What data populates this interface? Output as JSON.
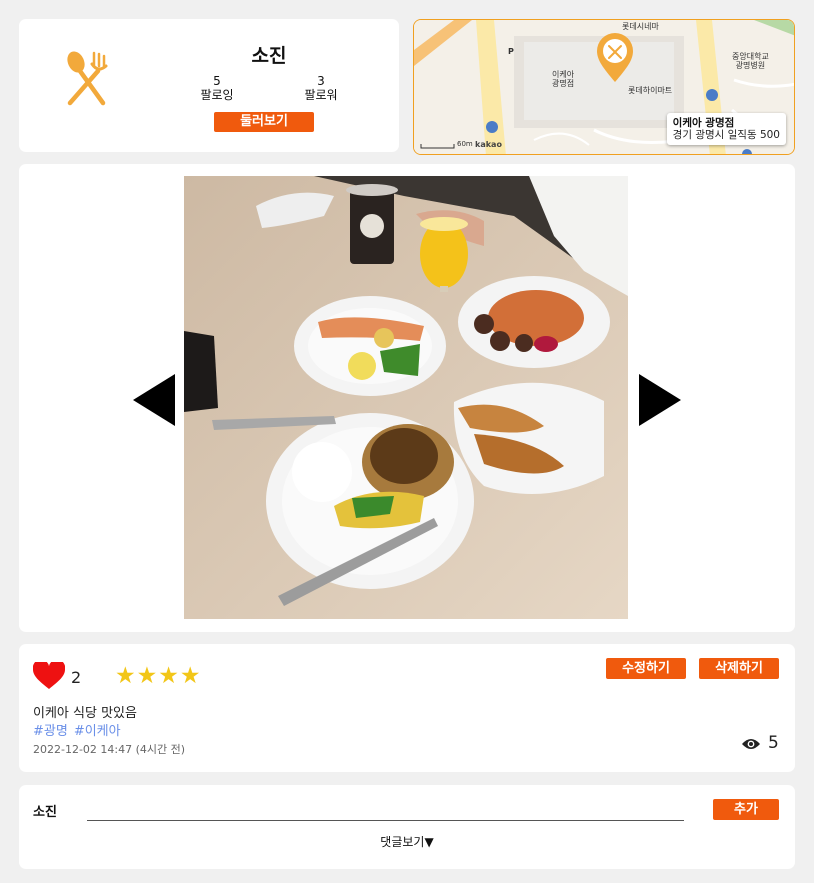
{
  "profile": {
    "icon": "fork-spoon-icon",
    "username": "소진",
    "following_count": "5",
    "following_label": "팔로잉",
    "followers_count": "3",
    "followers_label": "팔로워",
    "browse_label": "둘러보기"
  },
  "map": {
    "place_name": "이케아 광명점",
    "place_address": "경기 광명시 일직동 500",
    "labels": {
      "cinema": "롯데시네마",
      "ikea": "이케아\n광명점",
      "mart": "롯데하이마트",
      "hospital": "중앙대학교\n광명병원",
      "parking": "P"
    },
    "scale": "60m",
    "provider": "kakao"
  },
  "gallery": {
    "prev_icon": "arrow-left-icon",
    "next_icon": "arrow-right-icon"
  },
  "post": {
    "likes": "2",
    "stars": "★★★★",
    "edit_label": "수정하기",
    "delete_label": "삭제하기",
    "content": "이케아 식당 맛있음",
    "tags": [
      "#광명",
      "#이케아"
    ],
    "date": "2022-12-02 14:47 (4시간 전)",
    "views": "5"
  },
  "comment": {
    "user": "소진",
    "input_value": "",
    "add_label": "추가",
    "show_label": "댓글보기▼"
  },
  "colors": {
    "accent": "#f05a0d",
    "star": "#f2c618",
    "heart": "#ee1111",
    "tag": "#6a8fe8",
    "map_border": "#f0a020"
  }
}
